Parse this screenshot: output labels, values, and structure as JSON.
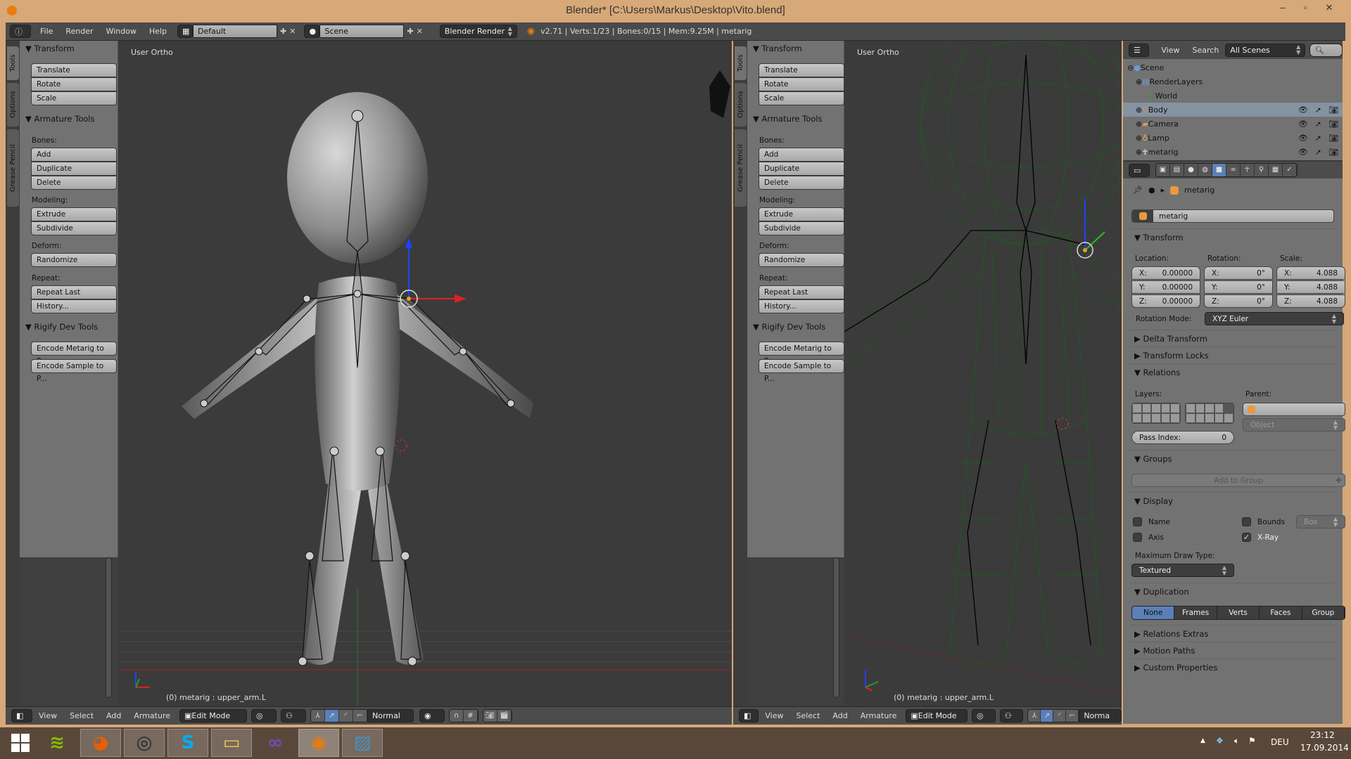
{
  "window": {
    "title": "Blender* [C:\\Users\\Markus\\Desktop\\Vito.blend]"
  },
  "topbar": {
    "menus": [
      "File",
      "Render",
      "Window",
      "Help"
    ],
    "layout": "Default",
    "scene": "Scene",
    "engine": "Blender Render",
    "stats": "v2.71 | Verts:1/23 | Bones:0/15 | Mem:9.25M | metarig"
  },
  "shelf": {
    "tabs": [
      "Tools",
      "Options",
      "Grease Pencil"
    ],
    "transform_header": "Transform",
    "transform_buttons": [
      "Translate",
      "Rotate",
      "Scale"
    ],
    "armature_header": "Armature Tools",
    "bones_label": "Bones:",
    "bones_buttons": [
      "Add",
      "Duplicate",
      "Delete"
    ],
    "modeling_label": "Modeling:",
    "modeling_buttons": [
      "Extrude",
      "Subdivide"
    ],
    "deform_label": "Deform:",
    "deform_buttons": [
      "Randomize"
    ],
    "repeat_label": "Repeat:",
    "repeat_buttons": [
      "Repeat Last",
      "History..."
    ],
    "rigify_header": "Rigify Dev Tools",
    "rigify_buttons": [
      "Encode Metarig to P...",
      "Encode Sample to P..."
    ]
  },
  "viewport_left": {
    "label": "User Ortho",
    "info": "(0) metarig : upper_arm.L"
  },
  "viewport_right": {
    "label": "User Ortho",
    "info": "(0) metarig : upper_arm.L"
  },
  "header3d": {
    "menus": [
      "View",
      "Select",
      "Add",
      "Armature"
    ],
    "mode": "Edit Mode",
    "orientation": "Normal",
    "orientation_right": "Norma"
  },
  "outliner": {
    "menus": [
      "View",
      "Search"
    ],
    "filter": "All Scenes",
    "items": [
      {
        "name": "Scene",
        "level": 0,
        "icon": "scene-icon"
      },
      {
        "name": "RenderLayers",
        "level": 1,
        "icon": "render-layers-icon"
      },
      {
        "name": "World",
        "level": 1,
        "icon": "world-icon"
      },
      {
        "name": "Body",
        "level": 1,
        "icon": "mesh-icon",
        "selected": true
      },
      {
        "name": "Camera",
        "level": 1,
        "icon": "camera-icon"
      },
      {
        "name": "Lamp",
        "level": 1,
        "icon": "lamp-icon"
      },
      {
        "name": "metarig",
        "level": 1,
        "icon": "armature-icon"
      }
    ]
  },
  "properties": {
    "breadcrumb": "metarig",
    "object_name": "metarig",
    "transform": {
      "header": "Transform",
      "location_label": "Location:",
      "rotation_label": "Rotation:",
      "scale_label": "Scale:",
      "location": [
        {
          "axis": "X:",
          "value": "0.00000"
        },
        {
          "axis": "Y:",
          "value": "0.00000"
        },
        {
          "axis": "Z:",
          "value": "0.00000"
        }
      ],
      "rotation": [
        {
          "axis": "X:",
          "value": "0°"
        },
        {
          "axis": "Y:",
          "value": "0°"
        },
        {
          "axis": "Z:",
          "value": "0°"
        }
      ],
      "scale": [
        {
          "axis": "X:",
          "value": "4.088"
        },
        {
          "axis": "Y:",
          "value": "4.088"
        },
        {
          "axis": "Z:",
          "value": "4.088"
        }
      ],
      "rotation_mode_label": "Rotation Mode:",
      "rotation_mode": "XYZ Euler"
    },
    "delta_transform": "Delta Transform",
    "transform_locks": "Transform Locks",
    "relations": {
      "header": "Relations",
      "layers_label": "Layers:",
      "parent_label": "Parent:",
      "parent_type": "Object",
      "pass_index_label": "Pass Index:",
      "pass_index": "0"
    },
    "groups": {
      "header": "Groups",
      "add_button": "Add to Group"
    },
    "display": {
      "header": "Display",
      "name": "Name",
      "axis": "Axis",
      "bounds": "Bounds",
      "bounds_type": "Box",
      "xray": "X-Ray",
      "name_checked": false,
      "axis_checked": false,
      "bounds_checked": false,
      "xray_checked": true,
      "max_draw_label": "Maximum Draw Type:",
      "max_draw": "Textured"
    },
    "duplication": {
      "header": "Duplication",
      "options": [
        "None",
        "Frames",
        "Verts",
        "Faces",
        "Group"
      ],
      "selected": "None"
    },
    "relations_extras": "Relations Extras",
    "motion_paths": "Motion Paths",
    "custom_properties": "Custom Properties"
  },
  "taskbar": {
    "apps": [
      "spotify",
      "firefox",
      "steam",
      "skype",
      "file-explorer",
      "visual-studio",
      "blender",
      "photos"
    ],
    "active": "blender",
    "language": "DEU",
    "time": "23:12",
    "date": "17.09.2014"
  },
  "colors": {
    "accent": "#5b80b8",
    "window": "#d7a878",
    "taskbar": "#59483a",
    "wireframe": "#1f5a1f"
  }
}
